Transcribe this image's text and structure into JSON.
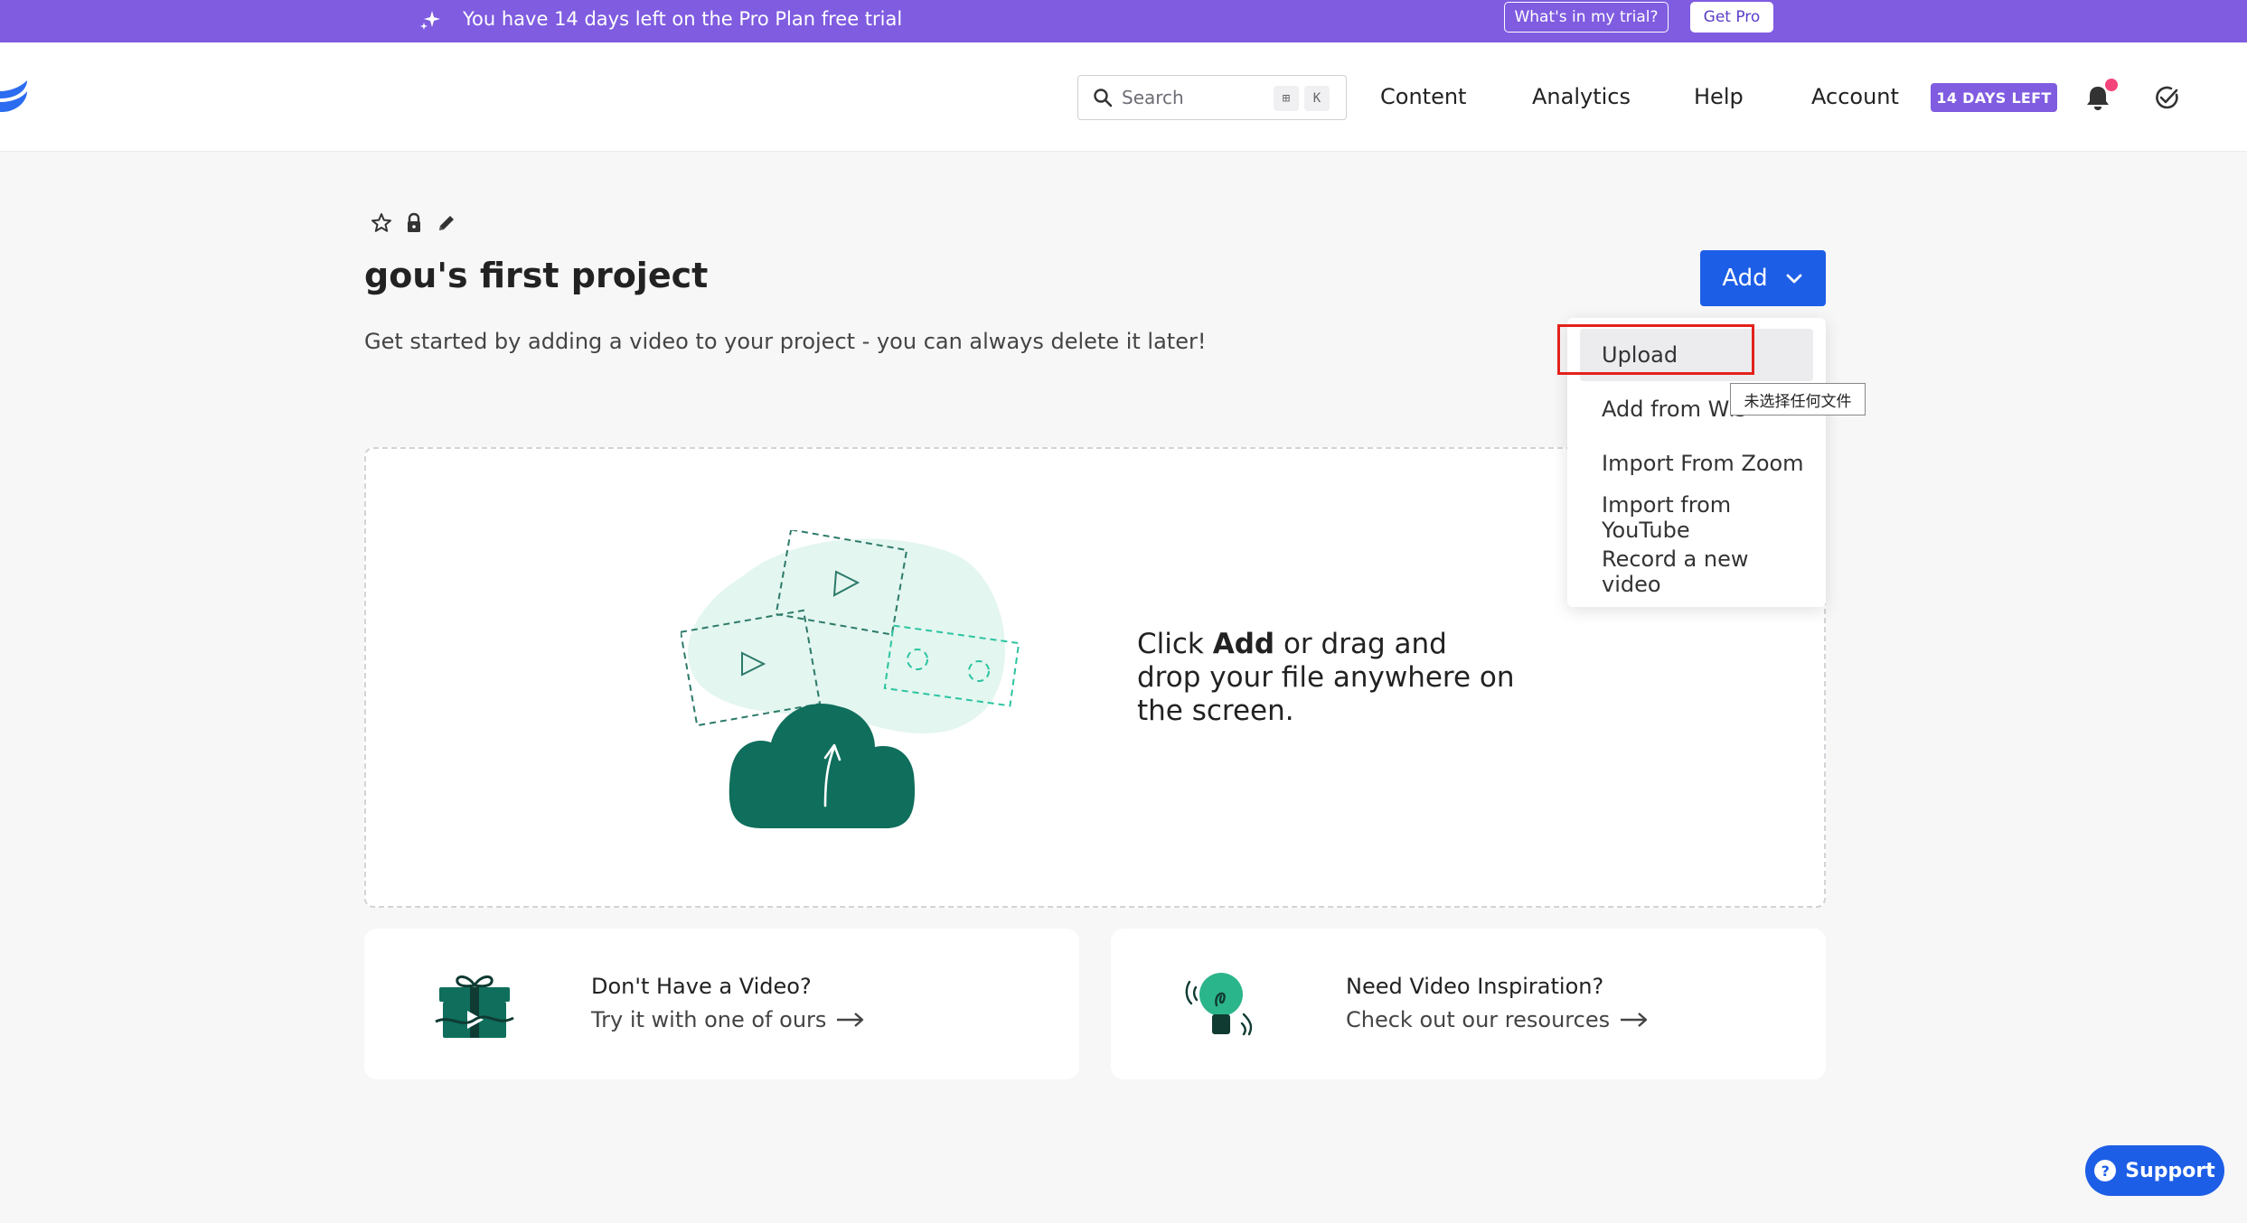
{
  "banner": {
    "message": "You have 14 days left on the Pro Plan free trial",
    "trial_button": "What's in my trial?",
    "pro_button": "Get Pro",
    "color": "#7f5ce0"
  },
  "header": {
    "search_placeholder": "Search",
    "kbd_1": "⊞",
    "kbd_2": "K",
    "nav": {
      "content": "Content",
      "analytics": "Analytics",
      "help": "Help",
      "account": "Account"
    },
    "days_badge": "14 DAYS LEFT",
    "icons": [
      "logo-icon",
      "search-icon",
      "bell-icon",
      "check-circle-icon"
    ]
  },
  "project": {
    "title": "gou's first project",
    "subtitle": "Get started by adding a video to your project - you can always delete it later!",
    "icons": [
      "star-icon",
      "lock-icon",
      "pencil-icon"
    ]
  },
  "add_button": {
    "label": "Add",
    "color": "#1d5ee6"
  },
  "menu": {
    "items": [
      "Upload",
      "Add from Wis",
      "Import From Zoom",
      "Import from YouTube",
      "Record a new video"
    ],
    "tooltip": "未选择任何文件"
  },
  "dropzone": {
    "text_before": "Click ",
    "text_bold": "Add",
    "text_after": " or drag and drop your file anywhere on the screen."
  },
  "cards": {
    "left": {
      "title": "Don't Have a Video?",
      "link": "Try it with one of ours"
    },
    "right": {
      "title": "Need Video Inspiration?",
      "link": "Check out our resources"
    }
  },
  "support": {
    "label": "Support",
    "icon_glyph": "?"
  },
  "colors": {
    "accent_purple": "#7f5ce0",
    "primary_blue": "#1d5ee6",
    "illustration_green": "#0f6e5c",
    "highlight_red": "#e3221c"
  }
}
